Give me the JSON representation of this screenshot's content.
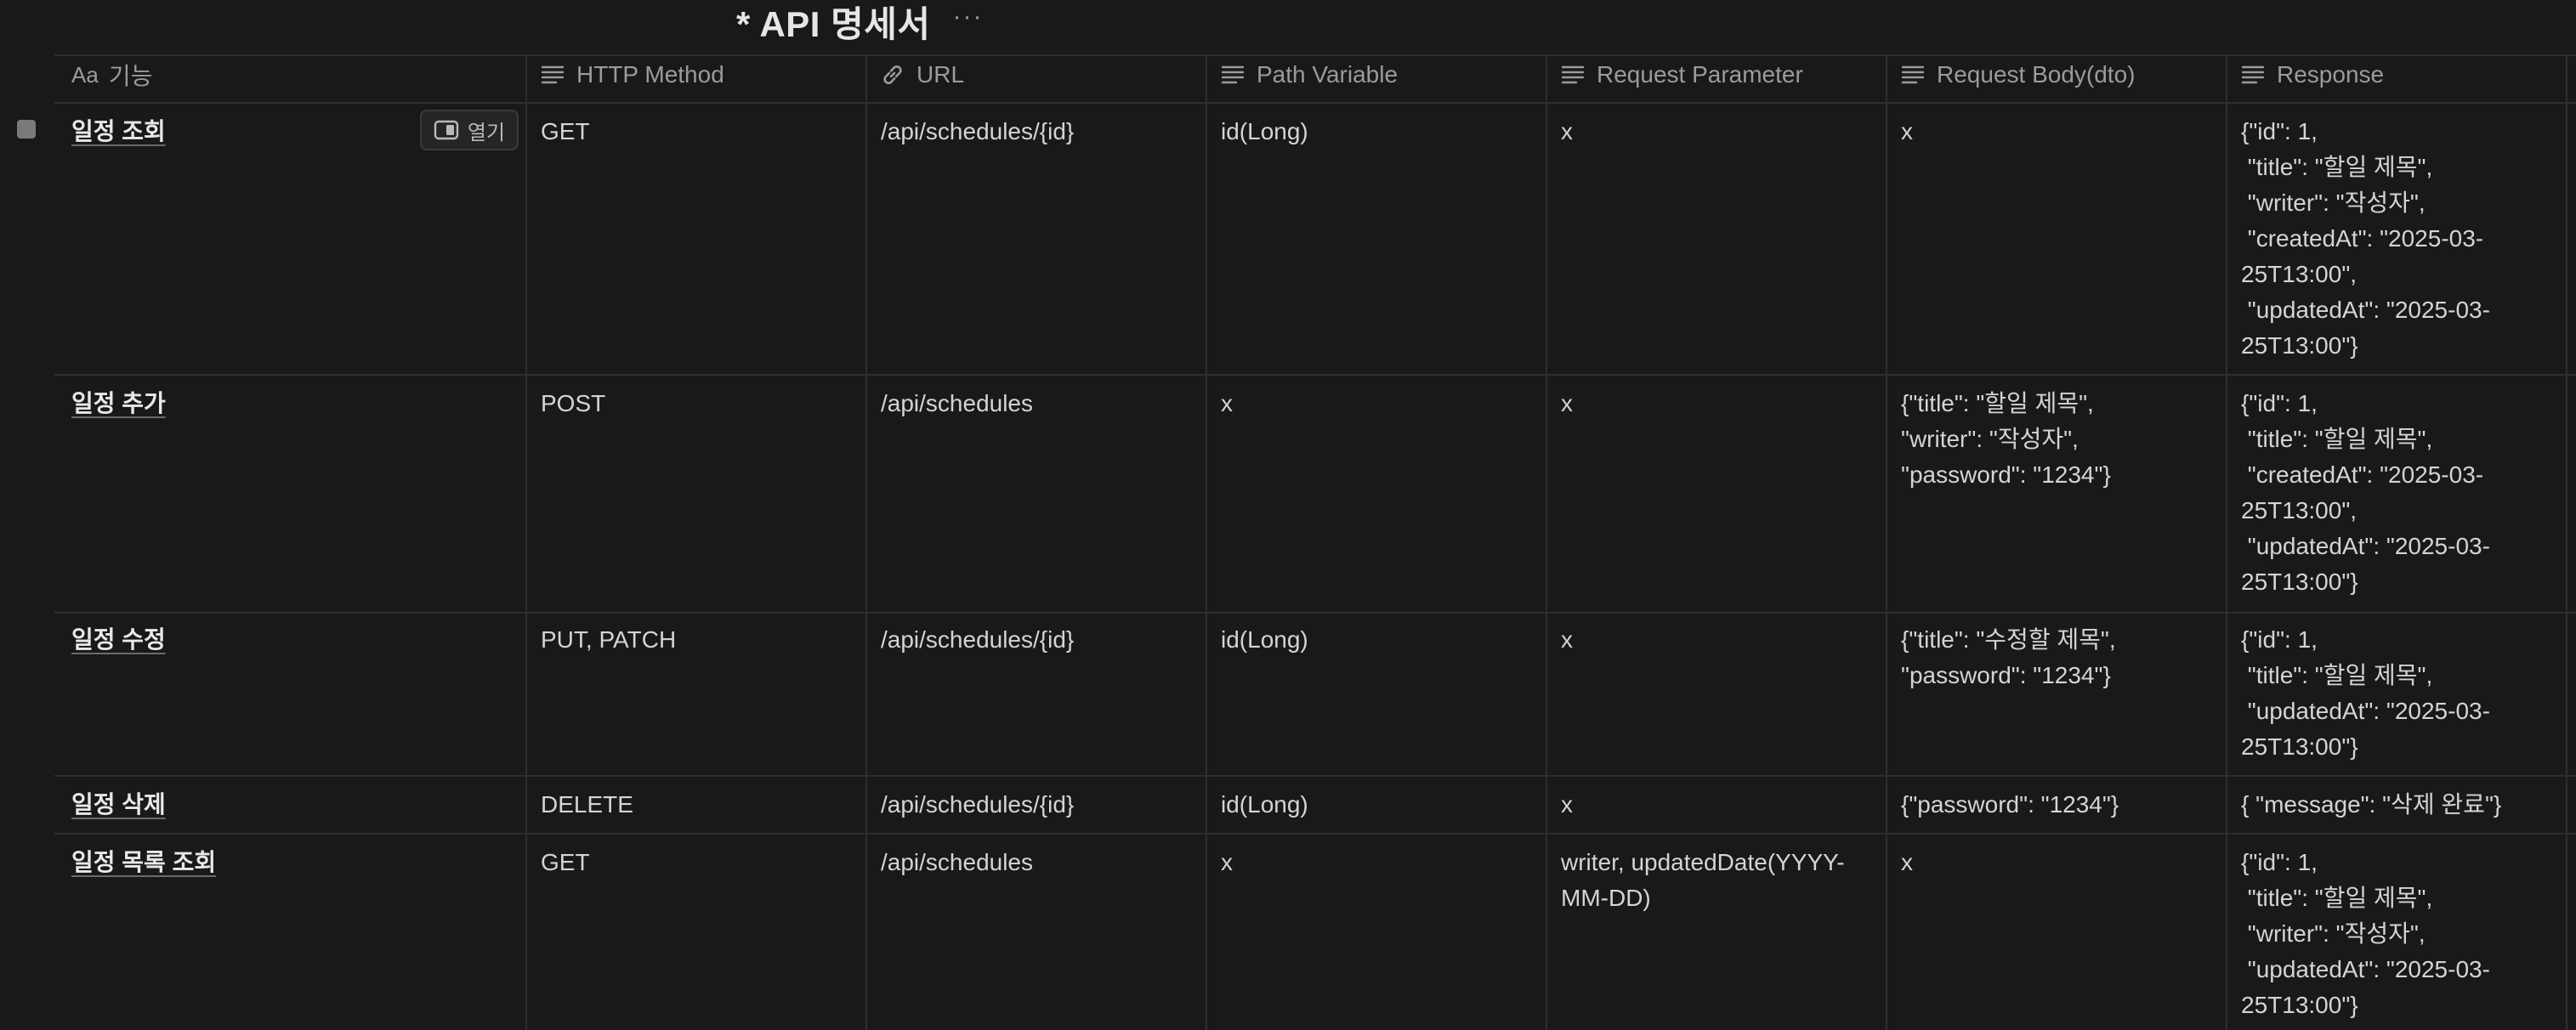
{
  "page": {
    "title": "* API 명세서",
    "more_label": "···"
  },
  "columns": [
    {
      "label": "기능",
      "prefix": "Aa",
      "icon": "title-icon"
    },
    {
      "label": "HTTP Method",
      "icon": "text-lines-icon"
    },
    {
      "label": "URL",
      "icon": "link-icon"
    },
    {
      "label": "Path Variable",
      "icon": "text-lines-icon"
    },
    {
      "label": "Request Parameter",
      "icon": "text-lines-icon"
    },
    {
      "label": "Request Body(dto)",
      "icon": "text-lines-icon"
    },
    {
      "label": "Response",
      "icon": "text-lines-icon"
    }
  ],
  "open_button": {
    "label": "열기",
    "icon": "side-peek-icon"
  },
  "rows": [
    {
      "name": "일정 조회",
      "method": "GET",
      "url": "/api/schedules/{id}",
      "path_variable": "id(Long)",
      "request_parameter": "x",
      "request_body": "x",
      "response": "{\"id\": 1,\n \"title\": \"할일 제목\",\n \"writer\": \"작성자\",\n \"createdAt\": \"2025-03-\n25T13:00\",\n \"updatedAt\": \"2025-03-\n25T13:00\"}"
    },
    {
      "name": "일정 추가",
      "method": "POST",
      "url": "/api/schedules",
      "path_variable": "x",
      "request_parameter": "x",
      "request_body": "{\"title\": \"할일 제목\",\n\"writer\": \"작성자\",\n\"password\": \"1234\"}",
      "response": "{\"id\": 1,\n \"title\": \"할일 제목\",\n \"createdAt\": \"2025-03-\n25T13:00\",\n \"updatedAt\": \"2025-03-\n25T13:00\"}"
    },
    {
      "name": "일정 수정",
      "method": "PUT, PATCH",
      "url": "/api/schedules/{id}",
      "path_variable": "id(Long)",
      "request_parameter": "x",
      "request_body": "{\"title\": \"수정할 제목\",\n\"password\": \"1234\"}",
      "response": "{\"id\": 1,\n \"title\": \"할일 제목\",\n \"updatedAt\": \"2025-03-\n25T13:00\"}"
    },
    {
      "name": "일정 삭제",
      "method": "DELETE",
      "url": "/api/schedules/{id}",
      "path_variable": "id(Long)",
      "request_parameter": "x",
      "request_body": "{\"password\": \"1234\"}",
      "response": "{ \"message\": \"삭제 완료\"}"
    },
    {
      "name": "일정 목록 조회",
      "method": "GET",
      "url": "/api/schedules",
      "path_variable": "x",
      "request_parameter": "writer, updatedDate(YYYY-\nMM-DD)",
      "request_body": "x",
      "response": "{\"id\": 1,\n \"title\": \"할일 제목\",\n \"writer\": \"작성자\",\n \"updatedAt\": \"2025-03-\n25T13:00\"}"
    }
  ]
}
